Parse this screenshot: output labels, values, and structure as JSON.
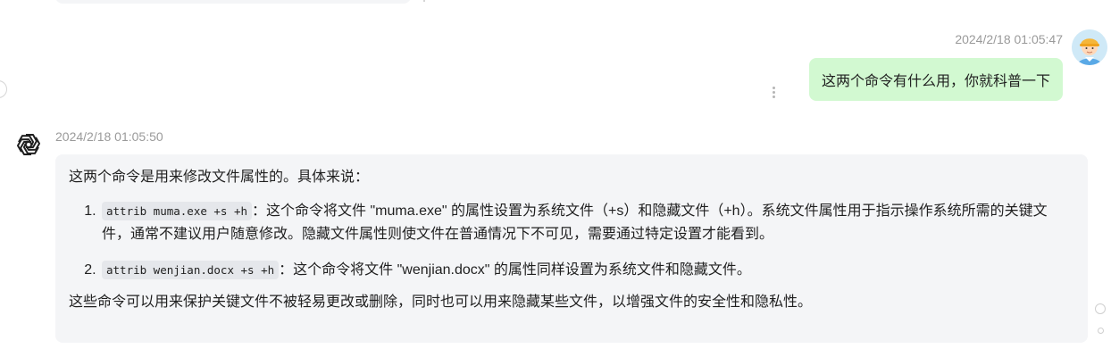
{
  "user_message": {
    "timestamp": "2024/2/18 01:05:47",
    "text": "这两个命令有什么用，你就科普一下"
  },
  "bot_message": {
    "timestamp": "2024/2/18 01:05:50",
    "intro": "这两个命令是用来修改文件属性的。具体来说：",
    "items": [
      {
        "number": "1.",
        "code": "attrib muma.exe +s +h",
        "text": "：这个命令将文件 \"muma.exe\" 的属性设置为系统文件（+s）和隐藏文件（+h）。系统文件属性用于指示操作系统所需的关键文件，通常不建议用户随意修改。隐藏文件属性则使文件在普通情况下不可见，需要通过特定设置才能看到。"
      },
      {
        "number": "2.",
        "code": "attrib wenjian.docx +s +h",
        "text": "：这个命令将文件 \"wenjian.docx\" 的属性同样设置为系统文件和隐藏文件。"
      }
    ],
    "outro": "这些命令可以用来保护关键文件不被轻易更改或删除，同时也可以用来隐藏某些文件，以增强文件的安全性和隐私性。"
  },
  "icons": {
    "user_avatar": "user-avatar-icon",
    "bot_avatar": "openai-logo-icon",
    "more": "more-vertical-icon"
  },
  "colors": {
    "user_bubble": "#d2f9d1",
    "bot_bubble": "#f4f5f7",
    "timestamp": "#9a9a9a"
  }
}
